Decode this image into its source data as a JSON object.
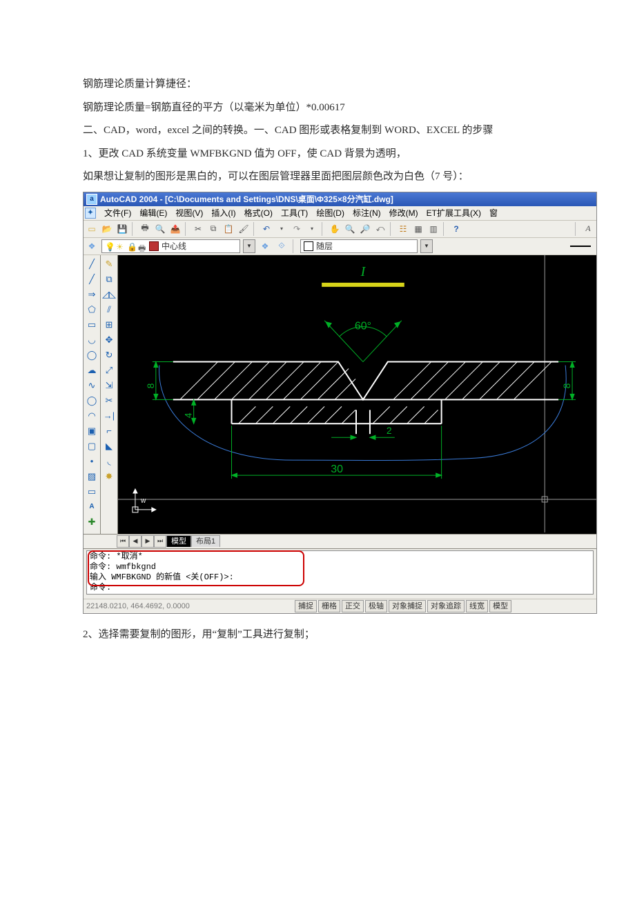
{
  "doc": {
    "p1": "钢筋理论质量计算捷径：",
    "p2": "钢筋理论质量=钢筋直径的平方（以毫米为单位）*0.00617",
    "p3": "二、CAD，word，excel 之间的转换。一、CAD 图形或表格复制到 WORD、EXCEL 的步骤",
    "p4": "1、更改 CAD 系统变量 WMFBKGND 值为 OFF，使 CAD 背景为透明，",
    "p5": "如果想让复制的图形是黑白的，可以在图层管理器里面把图层颜色改为白色（7 号）：",
    "p6": "2、选择需要复制的图形，用“复制”工具进行复制；"
  },
  "cad": {
    "title": "AutoCAD 2004 - [C:\\Documents and Settings\\DNS\\桌面\\Φ325×8分汽缸.dwg]",
    "menu": {
      "file": "文件(F)",
      "edit": "编辑(E)",
      "view": "视图(V)",
      "insert": "插入(I)",
      "format": "格式(O)",
      "tools": "工具(T)",
      "draw": "绘图(D)",
      "dim": "标注(N)",
      "modify": "修改(M)",
      "et": "ET扩展工具(X)",
      "window": "窗"
    },
    "layer": {
      "current": "中心线",
      "color_state": "随层"
    },
    "tabs": {
      "model": "模型",
      "layout1": "布局1"
    },
    "drawing": {
      "angle": "60°",
      "dim_bottom": "30",
      "dim_gap": "2",
      "dim_left_upper": "8",
      "dim_left_lower": "4",
      "dim_right": "8",
      "top_label": "I"
    },
    "cmd": {
      "l1": "命令:  *取消*",
      "l2": "命令:  wmfbkgnd",
      "l3": "输入  WMFBKGND 的新值 <关(OFF)>:",
      "l4": "命令:"
    },
    "status": {
      "coords": "22148.0210, 464.4692, 0.0000",
      "btns": [
        "捕捉",
        "栅格",
        "正交",
        "极轴",
        "对象捕捉",
        "对象追踪",
        "线宽",
        "模型"
      ]
    }
  }
}
